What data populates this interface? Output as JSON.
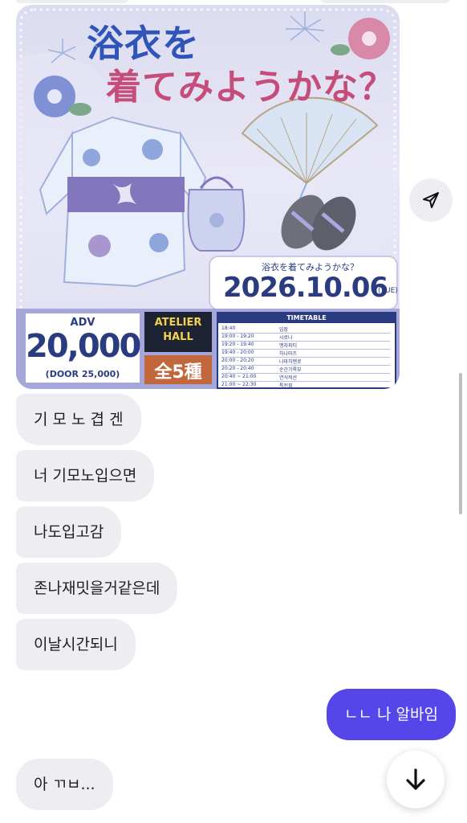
{
  "poster": {
    "title_line1": "浴衣を",
    "title_line2": "着てみようかな？",
    "date_subtitle": "浴衣を着てみようかな？",
    "date": "2026.10.06",
    "weekday": "(TUE)",
    "adv_label": "ADV",
    "price": "20,000",
    "door_price": "(DOOR 25,000)",
    "venue_line1": "ATELIER",
    "venue_line2": "HALL",
    "kinds": "全5種",
    "timetable_title": "TIMETABLE",
    "timetable": [
      {
        "time": "18:40",
        "act": "입장"
      },
      {
        "time": "19:00 - 19:20",
        "act": "시로나"
      },
      {
        "time": "19:20 - 19:40",
        "act": "멩차파티"
      },
      {
        "time": "19:40 - 20:00",
        "act": "하나마츠"
      },
      {
        "time": "20:00 - 20:20",
        "act": "나마히멘로"
      },
      {
        "time": "20:20 - 20:40",
        "act": "순간기록부"
      },
      {
        "time": "20:40 ~ 21:00",
        "act": "연식적션"
      },
      {
        "time": "21:00 ~ 22:30",
        "act": "특전회"
      }
    ]
  },
  "messages": [
    {
      "sender": "other",
      "text": "기 모 노 겹 겐"
    },
    {
      "sender": "other",
      "text": "너 기모노입으면"
    },
    {
      "sender": "other",
      "text": "나도입고감"
    },
    {
      "sender": "other",
      "text": "존나재밋을거같은데"
    },
    {
      "sender": "other",
      "text": "이날시간되니"
    },
    {
      "sender": "me",
      "text": "ㄴㄴ 나 알바임"
    },
    {
      "sender": "other",
      "text": "아 ㄲㅂ..."
    }
  ],
  "icons": {
    "forward": "send-icon",
    "scroll_down": "arrow-down-icon"
  },
  "colors": {
    "my_bubble": "#5546ea",
    "other_bubble": "#eeeef2",
    "poster_navy": "#2a3c7f",
    "poster_pink": "#c54d7a"
  }
}
